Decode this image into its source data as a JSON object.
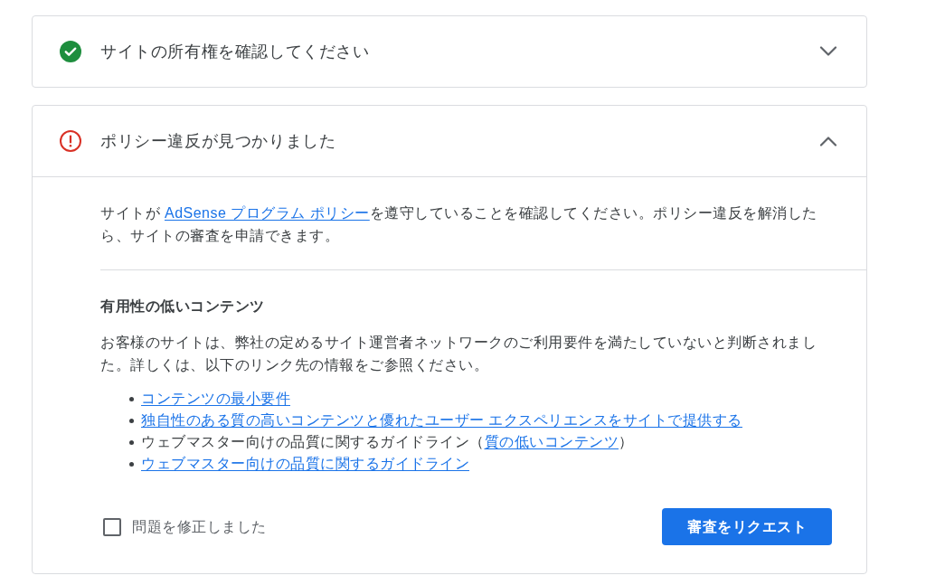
{
  "sections": [
    {
      "kind": "verified",
      "title": "サイトの所有権を確認してください",
      "expanded": false
    },
    {
      "kind": "violation",
      "title": "ポリシー違反が見つかりました",
      "expanded": true,
      "intro": [
        {
          "kind": "text",
          "text": "サイトが "
        },
        {
          "kind": "link",
          "text": "AdSense プログラム ポリシー"
        },
        {
          "kind": "text",
          "text": "を遵守していることを確認してください。ポリシー違反を解消したら、サイトの審査を申請できます。"
        }
      ],
      "issue": {
        "heading": "有用性の低いコンテンツ",
        "description": "お客様のサイトは、弊社の定めるサイト運営者ネットワークのご利用要件を満たしていないと判断されました。詳しくは、以下のリンク先の情報をご参照ください。",
        "items": [
          {
            "segments": [
              {
                "kind": "link",
                "text": "コンテンツの最小要件"
              }
            ]
          },
          {
            "segments": [
              {
                "kind": "link",
                "text": "独自性のある質の高いコンテンツと優れたユーザー エクスペリエンスをサイトで提供する"
              }
            ]
          },
          {
            "segments": [
              {
                "kind": "text",
                "text": "ウェブマスター向けの品質に関するガイドライン（"
              },
              {
                "kind": "link",
                "text": "質の低いコンテンツ"
              },
              {
                "kind": "text",
                "text": "）"
              }
            ]
          },
          {
            "segments": [
              {
                "kind": "link",
                "text": "ウェブマスター向けの品質に関するガイドライン"
              }
            ]
          }
        ]
      },
      "confirm": {
        "label": "問題を修正しました",
        "checked": false
      },
      "action": {
        "label": "審査をリクエスト"
      }
    }
  ]
}
